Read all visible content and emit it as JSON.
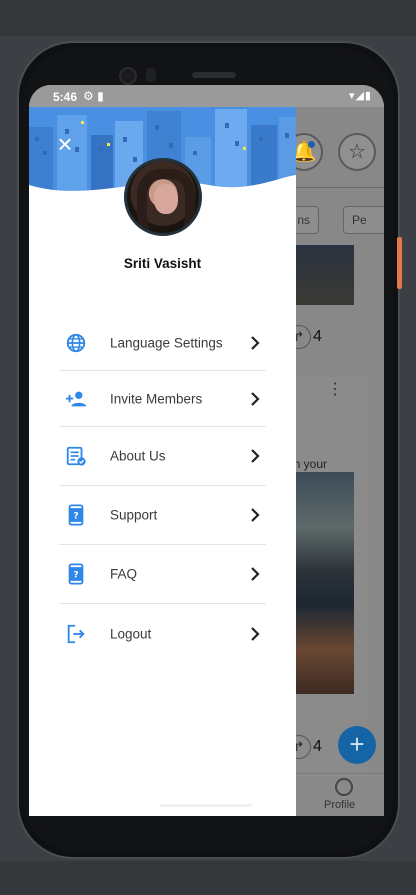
{
  "status_bar": {
    "time": "5:46",
    "left_icons": "⚙ ▮",
    "right_icons": "▾◢▮"
  },
  "drawer": {
    "close_icon": "×",
    "user_name": "Sriti Vasisht",
    "menu_items": [
      {
        "label": "Language Settings",
        "icon": "globe-icon"
      },
      {
        "label": "Invite Members",
        "icon": "add-person-icon"
      },
      {
        "label": "About Us",
        "icon": "document-check-icon"
      },
      {
        "label": "Support",
        "icon": "phone-question-icon"
      },
      {
        "label": "FAQ",
        "icon": "phone-question-icon"
      },
      {
        "label": "Logout",
        "icon": "logout-icon"
      }
    ],
    "accent_color": "#2f87e8"
  },
  "background_app": {
    "chip_partial_1": "ns",
    "chip_partial_2": "Pe",
    "share_count_1": "4",
    "share_count_2": "4",
    "partial_text": "on your",
    "profile_label": "Profile",
    "fab_label": "+"
  }
}
